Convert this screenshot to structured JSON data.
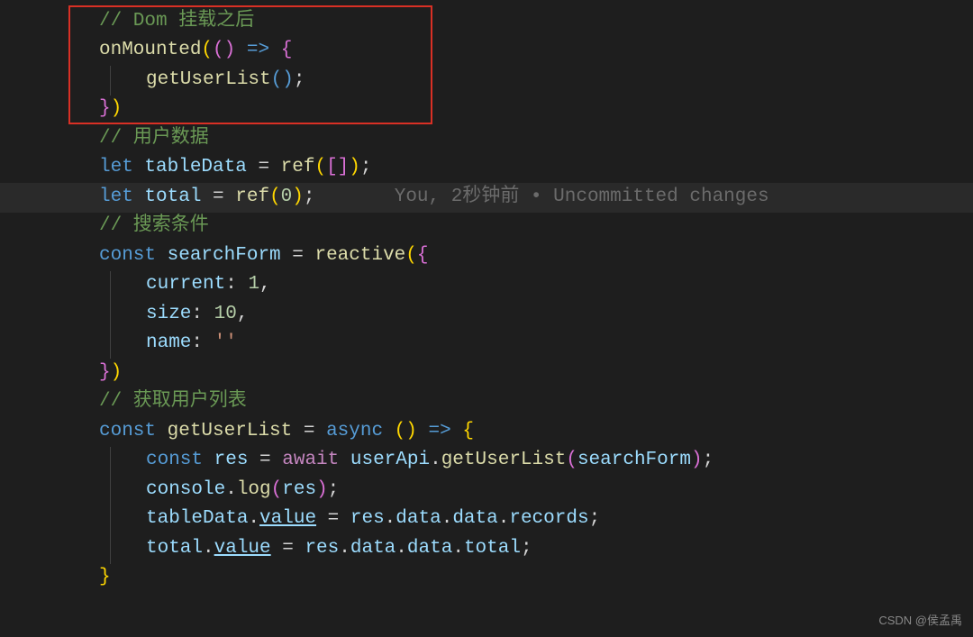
{
  "code": {
    "l1": "// Dom 挂载之后",
    "l2_func": "onMounted",
    "l2_rest": "(() => {",
    "l3_func": "getUserList",
    "l3_rest": "();",
    "l4": "})",
    "l5": "// 用户数据",
    "l6_let": "let",
    "l6_var": "tableData",
    "l6_eq": " = ",
    "l6_ref": "ref",
    "l6_paren": "([]);",
    "l7_let": "let",
    "l7_var": "total",
    "l7_eq": " = ",
    "l7_ref": "ref",
    "l7_open": "(",
    "l7_num": "0",
    "l7_close": ");",
    "l7_ghost": "You, 2秒钟前 • Uncommitted changes",
    "l8": "// 搜索条件",
    "l9_const": "const",
    "l9_var": "searchForm",
    "l9_eq": " = ",
    "l9_func": "reactive",
    "l9_rest": "({",
    "l10_prop": "current",
    "l10_colon": ": ",
    "l10_num": "1",
    "l10_comma": ",",
    "l11_prop": "size",
    "l11_colon": ": ",
    "l11_num": "10",
    "l11_comma": ",",
    "l12_prop": "name",
    "l12_colon": ": ",
    "l12_str": "''",
    "l13": "})",
    "l14": "// 获取用户列表",
    "l15_const": "const",
    "l15_var": "getUserList",
    "l15_eq": " = ",
    "l15_async": "async",
    "l15_parens": " () ",
    "l15_arrow": "=>",
    "l15_brace": " {",
    "l16_const": "const",
    "l16_var": "res",
    "l16_eq": " = ",
    "l16_await": "await",
    "l16_sp": " ",
    "l16_obj": "userApi",
    "l16_dot": ".",
    "l16_func": "getUserList",
    "l16_open": "(",
    "l16_arg": "searchForm",
    "l16_close": ");",
    "l17_obj": "console",
    "l17_dot": ".",
    "l17_func": "log",
    "l17_open": "(",
    "l17_arg": "res",
    "l17_close": ");",
    "l18_obj": "tableData",
    "l18_dot": ".",
    "l18_val": "value",
    "l18_eq": " = ",
    "l18_res": "res",
    "l18_d1": ".",
    "l18_data1": "data",
    "l18_d2": ".",
    "l18_data2": "data",
    "l18_d3": ".",
    "l18_rec": "records",
    "l18_semi": ";",
    "l19_obj": "total",
    "l19_dot": ".",
    "l19_val": "value",
    "l19_eq": " = ",
    "l19_res": "res",
    "l19_d1": ".",
    "l19_data1": "data",
    "l19_d2": ".",
    "l19_data2": "data",
    "l19_d3": ".",
    "l19_tot": "total",
    "l19_semi": ";",
    "l20": "}"
  },
  "watermark": "CSDN @侯孟禹"
}
